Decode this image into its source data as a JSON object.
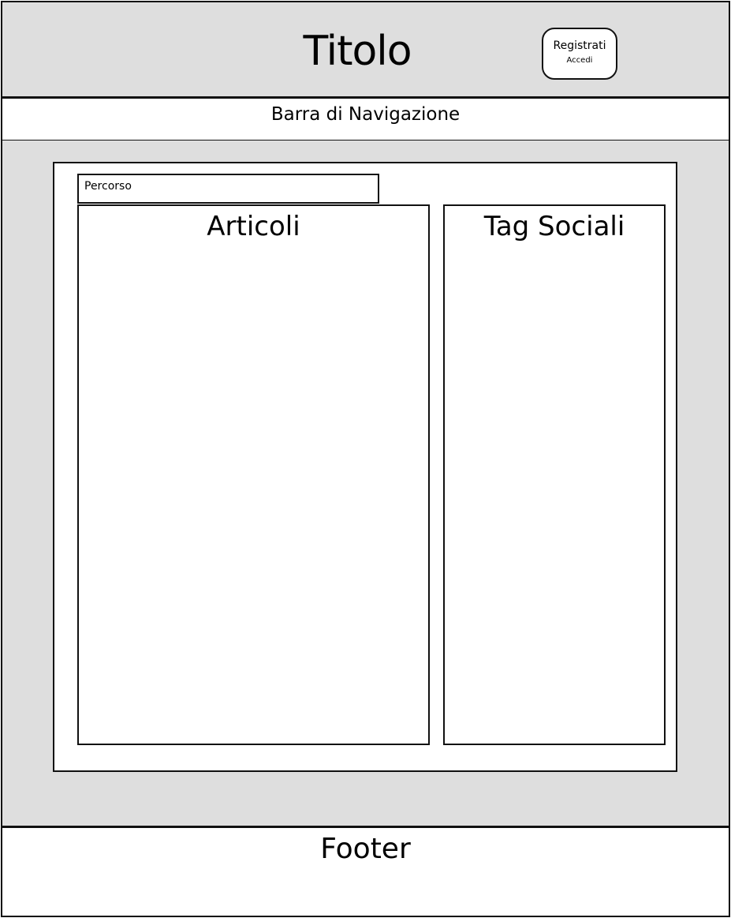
{
  "header": {
    "title": "Titolo",
    "auth": {
      "register_label": "Registrati",
      "login_label": "Accedi"
    }
  },
  "navbar": {
    "label": "Barra di Navigazione"
  },
  "main": {
    "breadcrumb": "Percorso",
    "articles_title": "Articoli",
    "tags_title": "Tag Sociali"
  },
  "footer": {
    "label": "Footer"
  },
  "colors": {
    "background_grey": "#dedede",
    "panel_white": "#ffffff",
    "stroke": "#111111"
  }
}
